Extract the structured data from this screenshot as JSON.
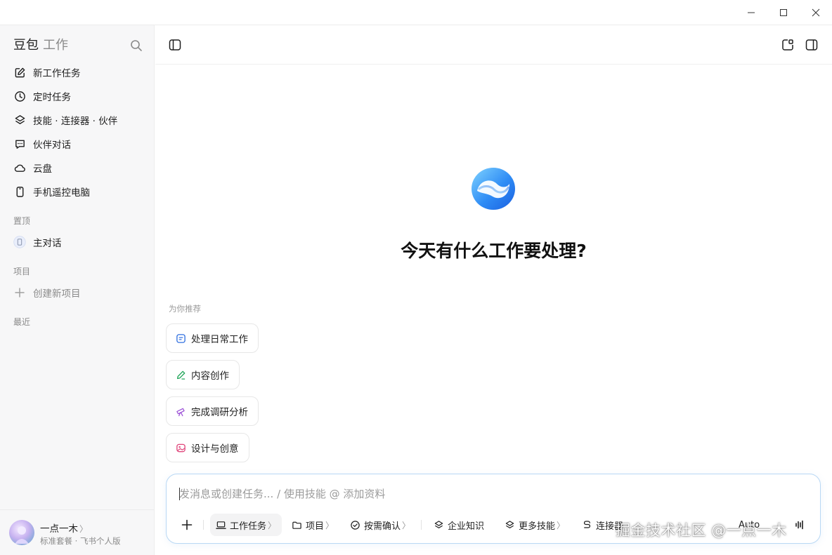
{
  "sidebar": {
    "brand_primary": "豆包",
    "brand_secondary": "工作",
    "nav": [
      {
        "label": "新工作任务",
        "icon": "edit-icon"
      },
      {
        "label": "定时任务",
        "icon": "clock-icon"
      },
      {
        "label": "技能 · 连接器 · 伙伴",
        "icon": "layers-icon"
      },
      {
        "label": "伙伴对话",
        "icon": "chat-bubble-icon"
      },
      {
        "label": "云盘",
        "icon": "cloud-icon"
      },
      {
        "label": "手机遥控电脑",
        "icon": "phone-icon"
      }
    ],
    "pinned_label": "置顶",
    "pinned_item": "主对话",
    "projects_label": "项目",
    "new_project": "创建新项目",
    "recent_label": "最近",
    "profile": {
      "name": "一点一木",
      "plan": "标准套餐 · 飞书个人版"
    }
  },
  "main": {
    "headline": "今天有什么工作要处理?",
    "recommend_label": "为你推荐",
    "chips": [
      {
        "label": "处理日常工作",
        "icon": "document-icon",
        "color": "#2f6fe0"
      },
      {
        "label": "内容创作",
        "icon": "pen-icon",
        "color": "#21a559"
      },
      {
        "label": "完成调研分析",
        "icon": "telescope-icon",
        "color": "#9b4fd6"
      },
      {
        "label": "设计与创意",
        "icon": "image-icon",
        "color": "#e0457b"
      }
    ]
  },
  "composer": {
    "placeholder": "发消息或创建任务... / 使用技能 @ 添加资料",
    "tools": [
      {
        "label": "工作任务",
        "icon": "laptop-icon"
      },
      {
        "label": "项目",
        "icon": "folder-icon"
      },
      {
        "label": "按需确认",
        "icon": "check-circle-icon"
      },
      {
        "label": "企业知识",
        "icon": "layers-icon"
      },
      {
        "label": "更多技能",
        "icon": "layers-icon"
      },
      {
        "label": "连接器",
        "icon": "link-icon"
      }
    ],
    "model": "Auto"
  },
  "watermark": "掘金技术社区 @一点一木",
  "colors": {
    "accent": "#2b7ff0",
    "sidebar_bg": "#f7f7f8"
  }
}
